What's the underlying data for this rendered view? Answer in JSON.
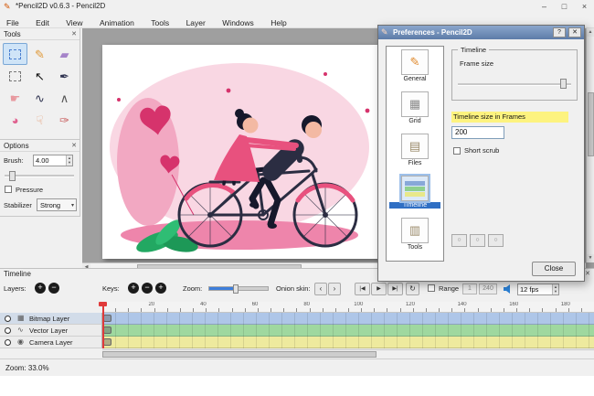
{
  "app": {
    "title": "*Pencil2D v0.6.3 - Pencil2D",
    "window_buttons": {
      "minimize": "–",
      "maximize": "□",
      "close": "×"
    },
    "menu": [
      "File",
      "Edit",
      "View",
      "Animation",
      "Tools",
      "Layer",
      "Windows",
      "Help"
    ]
  },
  "tools_panel": {
    "title": "Tools",
    "close_glyph": "✕",
    "tools": [
      {
        "name": "select",
        "glyph": "",
        "color": "#4a7fd0"
      },
      {
        "name": "pencil",
        "glyph": "✎",
        "color": "#e09a3a"
      },
      {
        "name": "eraser",
        "glyph": "▰",
        "color": "#a583c9"
      },
      {
        "name": "marquee",
        "glyph": "",
        "color": "#777777"
      },
      {
        "name": "move",
        "glyph": "↖",
        "color": "#111111"
      },
      {
        "name": "pen",
        "glyph": "✒",
        "color": "#2f3350"
      },
      {
        "name": "hand",
        "glyph": "☛",
        "color": "#e8999f"
      },
      {
        "name": "brush",
        "glyph": "∿",
        "color": "#2f3350"
      },
      {
        "name": "polyline",
        "glyph": "∧",
        "color": "#555555"
      },
      {
        "name": "bucket",
        "glyph": "◕",
        "color": "#e0618f"
      },
      {
        "name": "smudge",
        "glyph": "☟",
        "color": "#e5a27c"
      },
      {
        "name": "eyedropper",
        "glyph": "✑",
        "color": "#c95f5f"
      }
    ]
  },
  "options_panel": {
    "title": "Options",
    "close_glyph": "✕",
    "brush_label": "Brush:",
    "brush_value": "4.00",
    "pressure_label": "Pressure",
    "stabilizer_label": "Stabilizer",
    "stabilizer_value": "Strong"
  },
  "preferences": {
    "title": "Preferences - Pencil2D",
    "help_button": "?",
    "close_glyph": "✕",
    "categories": [
      {
        "label": "General",
        "glyph": "✎"
      },
      {
        "label": "Grid",
        "glyph": "▦"
      },
      {
        "label": "Files",
        "glyph": "▤"
      },
      {
        "label": "Timeline",
        "glyph": ""
      },
      {
        "label": "Tools",
        "glyph": "▥"
      }
    ],
    "selected_category": "Timeline",
    "group_title": "Timeline",
    "frame_size_label": "Frame size",
    "timeline_size_label": "Timeline size in Frames",
    "timeline_size_value": "200",
    "short_scrub_label": "Short scrub",
    "close_label": "Close"
  },
  "timeline_panel": {
    "title": "Timeline",
    "close_glyph": "✕",
    "layers_label": "Layers:",
    "keys_label": "Keys:",
    "zoom_label": "Zoom:",
    "onion_label": "Onion skin:",
    "play_prev": "|◀",
    "play": "▶",
    "play_next": "▶|",
    "loop_glyph": "↻",
    "range_label": "Range",
    "range_start": "1",
    "range_end": "240",
    "fps_value": "12 fps",
    "ruler_numbers": [
      "20",
      "40",
      "60",
      "80",
      "100",
      "120",
      "140",
      "160",
      "180"
    ],
    "layers": [
      {
        "name": "Bitmap Layer",
        "icon": "▦",
        "track_color": "#aec6e8"
      },
      {
        "name": "Vector Layer",
        "icon": "∿",
        "track_color": "#9fd89f"
      },
      {
        "name": "Camera Layer",
        "icon": "◉",
        "track_color": "#eeea9e"
      }
    ]
  },
  "status_bar": {
    "zoom_text": "Zoom: 33.0%"
  }
}
